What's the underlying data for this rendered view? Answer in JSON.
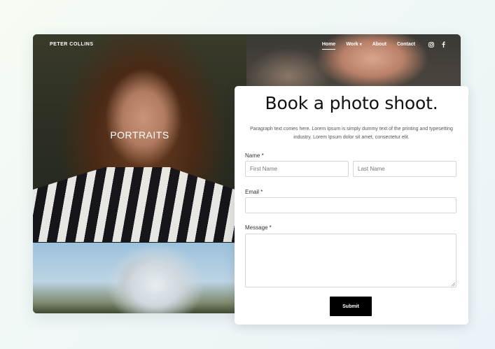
{
  "site": {
    "brand": "PETER COLLINS",
    "nav": [
      {
        "label": "Home",
        "active": true
      },
      {
        "label": "Work",
        "has_dropdown": true
      },
      {
        "label": "About"
      },
      {
        "label": "Contact"
      }
    ],
    "social_icons": [
      "instagram-icon",
      "facebook-icon"
    ],
    "gallery": {
      "portraits_label": "PORTRAITS"
    }
  },
  "form": {
    "title": "Book a photo shoot.",
    "description": "Paragraph text comes here. Lorem Ipsum is simply dummy text of the printing and typesetting industry. Lorem Ipsum dolor sit amet, consectetur elit.",
    "name_label": "Name *",
    "first_name_placeholder": "First Name",
    "last_name_placeholder": "Last Name",
    "email_label": "Email *",
    "message_label": "Message *",
    "submit_label": "Submit"
  },
  "colors": {
    "button_bg": "#000000",
    "card_bg": "#ffffff",
    "text_dark": "#111111"
  }
}
